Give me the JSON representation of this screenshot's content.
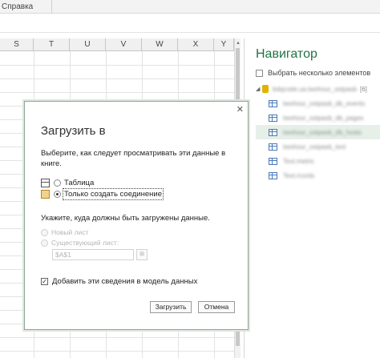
{
  "menu": {
    "help": "Справка"
  },
  "sheet": {
    "columns": [
      "S",
      "T",
      "U",
      "V",
      "W",
      "X",
      "Y"
    ]
  },
  "navigator": {
    "title": "Навигатор",
    "select_multiple": "Выбрать несколько элементов",
    "source": {
      "name": "bdqcode.ua.twohour_ostpasb",
      "count": "[6]"
    },
    "items": [
      {
        "name": "twohour_ostpasb_db_events",
        "selected": false
      },
      {
        "name": "twohour_ostpasb_db_pages",
        "selected": false
      },
      {
        "name": "twohour_ostpasb_db_hosts",
        "selected": true
      },
      {
        "name": "twohour_ostpasb_text",
        "selected": false
      },
      {
        "name": "Text.metrix",
        "selected": false
      },
      {
        "name": "Text.rcords",
        "selected": false
      }
    ]
  },
  "dialog": {
    "title": "Загрузить в",
    "prompt": "Выберите, как следует просматривать эти данные в книге.",
    "option_table": "Таблица",
    "option_connection": "Только создать соединение",
    "where_prompt": "Укажите, куда должны быть загружены данные.",
    "option_new_sheet": "Новый лист",
    "option_existing_sheet": "Существующий лист:",
    "range_value": "$A$1",
    "add_to_model": "Добавить эти сведения в модель данных",
    "add_to_model_checked": true,
    "load_button": "Загрузить",
    "cancel_button": "Отмена"
  }
}
